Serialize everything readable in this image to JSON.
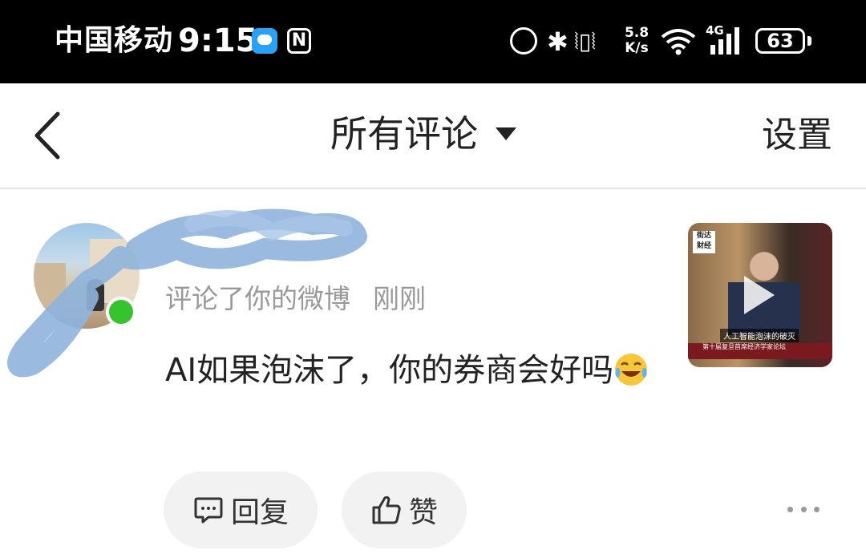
{
  "status_bar": {
    "carrier": "中国移动",
    "time": "9:15",
    "nfc": "N",
    "net_speed_value": "5.8",
    "net_speed_unit": "K/s",
    "network_type": "4G",
    "battery": "63"
  },
  "header": {
    "title": "所有评论",
    "settings": "设置"
  },
  "comment": {
    "username": "",
    "meta_action": "评论了你的微博",
    "meta_time": "刚刚",
    "text": "AI如果泡沫了，你的券商会好吗",
    "emoji": "laugh-tears-emoji"
  },
  "thumbnail": {
    "logo": "街达 财经",
    "caption": "人工智能泡沫的破灭",
    "banner": "第十届复旦首席经济学家论坛"
  },
  "actions": {
    "reply_label": "回复",
    "like_label": "赞"
  },
  "colors": {
    "online": "#37c32d",
    "button_bg": "#f2f2f2",
    "meta_text": "#999999"
  }
}
